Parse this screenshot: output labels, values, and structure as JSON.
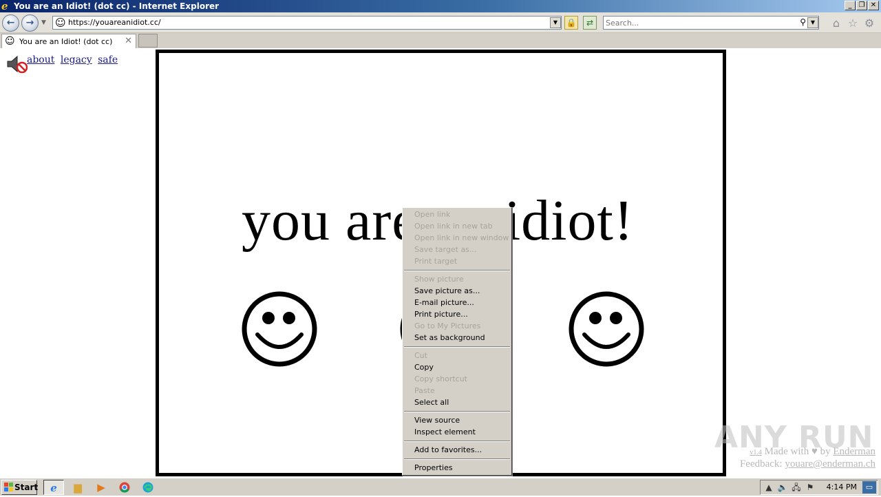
{
  "window": {
    "title": "You are an Idiot! (dot cc) - Internet Explorer",
    "buttons": {
      "minimize": "_",
      "maximize": "❐",
      "close": "✕"
    }
  },
  "toolbar": {
    "back_icon": "back-arrow-icon",
    "forward_icon": "forward-arrow-icon",
    "address": "https://youareanidiot.cc/",
    "search_placeholder": "Search..."
  },
  "tabs": [
    {
      "label": "You are an Idiot! (dot cc)",
      "active": true
    }
  ],
  "page": {
    "links": [
      "about",
      "legacy",
      "safe"
    ],
    "headline": "you are an idiot!",
    "credits": {
      "version": "v1.4",
      "made_with": "Made with",
      "by": "by",
      "author": "Enderman",
      "feedback_label": "Feedback:",
      "feedback_email": "youare@enderman.ch"
    },
    "watermark": "ANY RUN"
  },
  "context_menu": {
    "items": [
      {
        "label": "Open link",
        "enabled": false
      },
      {
        "label": "Open link in new tab",
        "enabled": false
      },
      {
        "label": "Open link in new window",
        "enabled": false
      },
      {
        "label": "Save target as...",
        "enabled": false
      },
      {
        "label": "Print target",
        "enabled": false
      },
      {
        "label": "Show picture",
        "enabled": false
      },
      {
        "label": "Save picture as...",
        "enabled": true
      },
      {
        "label": "E-mail picture...",
        "enabled": true
      },
      {
        "label": "Print picture...",
        "enabled": true
      },
      {
        "label": "Go to My Pictures",
        "enabled": false
      },
      {
        "label": "Set as background",
        "enabled": true
      },
      {
        "label": "Cut",
        "enabled": false
      },
      {
        "label": "Copy",
        "enabled": true
      },
      {
        "label": "Copy shortcut",
        "enabled": false
      },
      {
        "label": "Paste",
        "enabled": false
      },
      {
        "label": "Select all",
        "enabled": true
      },
      {
        "label": "View source",
        "enabled": true
      },
      {
        "label": "Inspect element",
        "enabled": true
      },
      {
        "label": "Add to favorites...",
        "enabled": true
      },
      {
        "label": "Properties",
        "enabled": true
      }
    ]
  },
  "taskbar": {
    "start_label": "Start",
    "apps": [
      "internet-explorer",
      "file-explorer",
      "media-player",
      "chrome",
      "edge"
    ],
    "clock": "4:14 PM"
  },
  "colors": {
    "titlebar_start": "#0a246a",
    "titlebar_end": "#a6caf0",
    "chrome_gray": "#d4d0c8",
    "link": "#1a1a8a",
    "disabled_text": "#a8a49c"
  }
}
